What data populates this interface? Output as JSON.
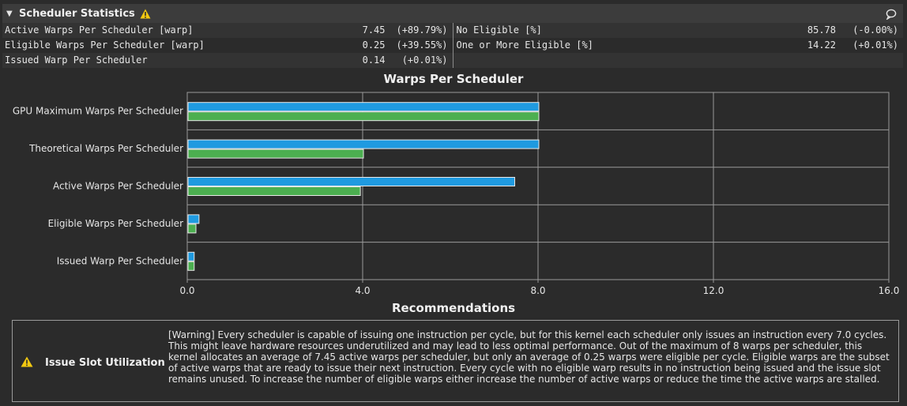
{
  "section": {
    "title": "Scheduler Statistics"
  },
  "stats": {
    "left": [
      {
        "label": "Active Warps Per Scheduler [warp]",
        "value": "7.45",
        "delta": "(+89.79%)"
      },
      {
        "label": "Eligible Warps Per Scheduler [warp]",
        "value": "0.25",
        "delta": "(+39.55%)"
      },
      {
        "label": "Issued Warp Per Scheduler",
        "value": "0.14",
        "delta": "(+0.01%)"
      }
    ],
    "right": [
      {
        "label": "No Eligible [%]",
        "value": "85.78",
        "delta": "(-0.00%)"
      },
      {
        "label": "One or More Eligible [%]",
        "value": "14.22",
        "delta": "(+0.01%)"
      }
    ]
  },
  "chart_data": {
    "type": "bar",
    "orientation": "horizontal",
    "title": "Warps Per Scheduler",
    "categories": [
      "GPU Maximum Warps Per Scheduler",
      "Theoretical Warps Per Scheduler",
      "Active Warps Per Scheduler",
      "Eligible Warps Per Scheduler",
      "Issued Warp Per Scheduler"
    ],
    "series": [
      {
        "color": "#1f9ae0",
        "values": [
          8.0,
          8.0,
          7.45,
          0.25,
          0.14
        ]
      },
      {
        "color": "#4caf50",
        "values": [
          8.0,
          4.0,
          3.93,
          0.18,
          0.14
        ]
      }
    ],
    "xlim": [
      0,
      16
    ],
    "xticks": [
      "0.0",
      "4.0",
      "8.0",
      "12.0",
      "16.0"
    ],
    "grid": true,
    "xlabel": "",
    "ylabel": ""
  },
  "recommendations": {
    "title": "Recommendations",
    "items": [
      {
        "name": "Issue Slot Utilization",
        "text": "[Warning] Every scheduler is capable of issuing one instruction per cycle, but for this kernel each scheduler only issues an instruction every 7.0 cycles. This might leave hardware resources underutilized and may lead to less optimal performance. Out of the maximum of 8 warps per scheduler, this kernel allocates an average of 7.45 active warps per scheduler, but only an average of 0.25 warps were eligible per cycle. Eligible warps are the subset of active warps that are ready to issue their next instruction. Every cycle with no eligible warp results in no instruction being issued and the issue slot remains unused. To increase the number of eligible warps either increase the number of active warps or reduce the time the active warps are stalled."
      }
    ]
  },
  "icons": {
    "collapse": "chevron-down-icon",
    "warning": "warning-icon",
    "comment": "comment-icon"
  },
  "colors": {
    "warning": "#f2c811",
    "active": "#1f9ae0",
    "eligible": "#4caf50"
  }
}
